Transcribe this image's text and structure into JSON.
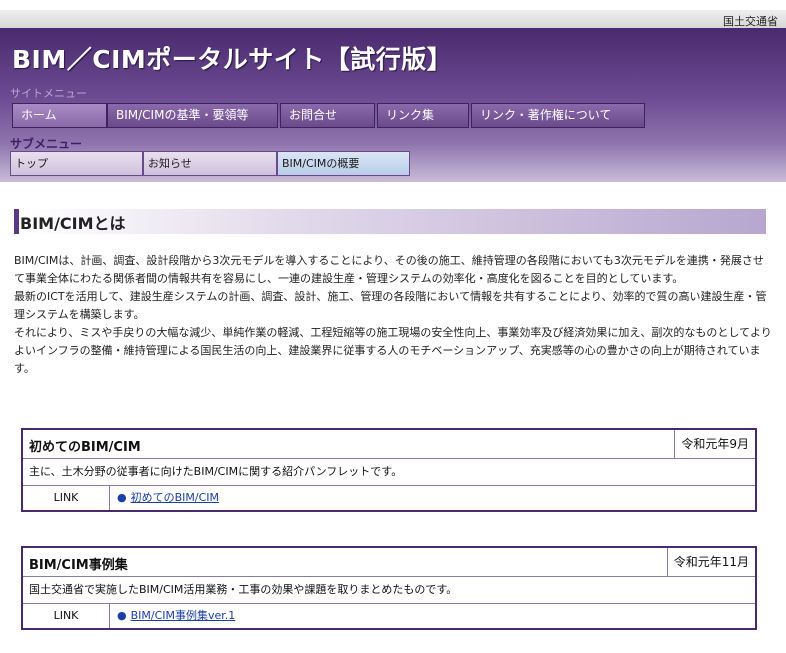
{
  "header": {
    "ministry": "国土交通省",
    "site_title": "BIM／CIMポータルサイト【試行版】",
    "site_menu_label": "サイトメニュー",
    "nav": [
      {
        "label": "ホーム"
      },
      {
        "label": "BIM/CIMの基準・要領等"
      },
      {
        "label": "お問合せ"
      },
      {
        "label": "リンク集"
      },
      {
        "label": "リンク・著作権について"
      }
    ],
    "sub_menu_label": "サブメニュー",
    "sub_nav": [
      {
        "label": "トップ"
      },
      {
        "label": "お知らせ"
      },
      {
        "label": "BIM/CIMの概要"
      }
    ]
  },
  "main": {
    "section_title": "BIM/CIMとは",
    "intro_paragraphs": [
      "BIM/CIMは、計画、調査、設計段階から3次元モデルを導入することにより、その後の施工、維持管理の各段階においても3次元モデルを連携・発展させて事業全体にわたる関係者間の情報共有を容易にし、一連の建設生産・管理システムの効率化・高度化を図ることを目的としています。",
      "最新のICTを活用して、建設生産システムの計画、調査、設計、施工、管理の各段階において情報を共有することにより、効率的で質の高い建設生産・管理システムを構築します。",
      "それにより、ミスや手戻りの大幅な減少、単純作業の軽減、工程短縮等の施工現場の安全性向上、事業効率及び経済効果に加え、副次的なものとしてよりよいインフラの整備・維持管理による国民生活の向上、建設業界に従事する人のモチベーションアップ、充実感等の心の豊かさの向上が期待されています。"
    ],
    "cards": [
      {
        "title": "初めてのBIM/CIM",
        "date": "令和元年9月",
        "description": "主に、土木分野の従事者に向けたBIM/CIMに関する紹介パンフレットです。",
        "link_label": "LINK",
        "link_text": "初めてのBIM/CIM"
      },
      {
        "title": "BIM/CIM事例集",
        "date": "令和元年11月",
        "description": "国土交通省で実施したBIM/CIM活用業務・工事の効果や課題を取りまとめたものです。",
        "link_label": "LINK",
        "link_text": "BIM/CIM事例集ver.1"
      }
    ]
  },
  "colors": {
    "brand_purple": "#4a2a6e",
    "link_blue": "#1a3fa8"
  },
  "icons": {
    "link_bullet": "filled-circle-icon"
  }
}
